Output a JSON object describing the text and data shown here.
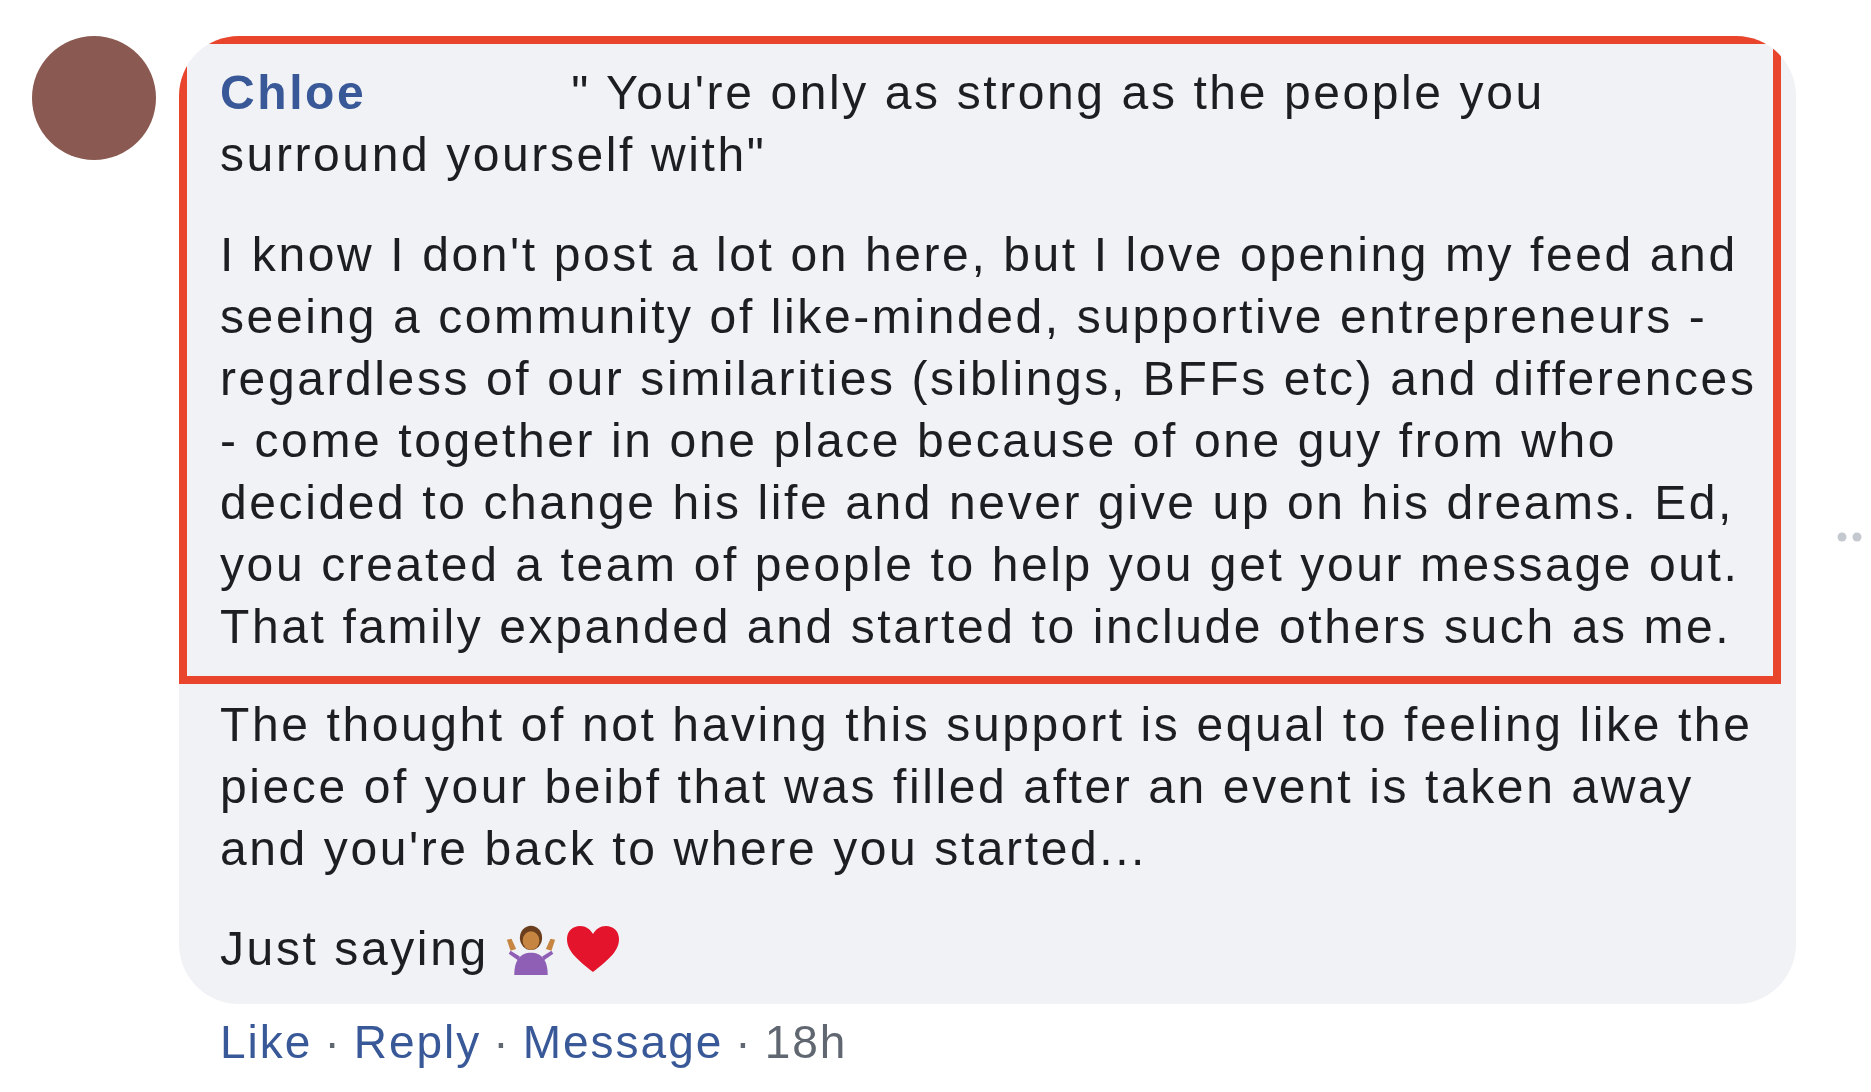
{
  "comment": {
    "author": "Chloe",
    "quote": "\" You're only as strong as the people you surround yourself with\"",
    "paragraphs": [
      {
        "text": "I know I don't post a lot on here, but I love opening my feed and seeing a community of like-minded, supportive entrepreneurs - regardless of our similarities (siblings, BFFs etc) and differences - come together in one place because of one guy from who decided to change his life and never give up on his dreams. Ed, you created a team of people to help you get your message out. That family expanded and started to include others such as me.",
        "highlighted": true
      },
      {
        "text": "The thought of not having this support is equal to feeling like the piece of your beibf that was filled after an event is taken away and you're back to where you started...",
        "highlighted": false
      }
    ],
    "closing": "Just saying",
    "actions": [
      {
        "kind": "link",
        "text": "Like"
      },
      {
        "kind": "separator",
        "text": "·"
      },
      {
        "kind": "link",
        "text": "Reply"
      },
      {
        "kind": "separator",
        "text": "·"
      },
      {
        "kind": "link",
        "text": "Message"
      },
      {
        "kind": "separator",
        "text": "·"
      },
      {
        "kind": "time",
        "text": "18h"
      }
    ]
  }
}
